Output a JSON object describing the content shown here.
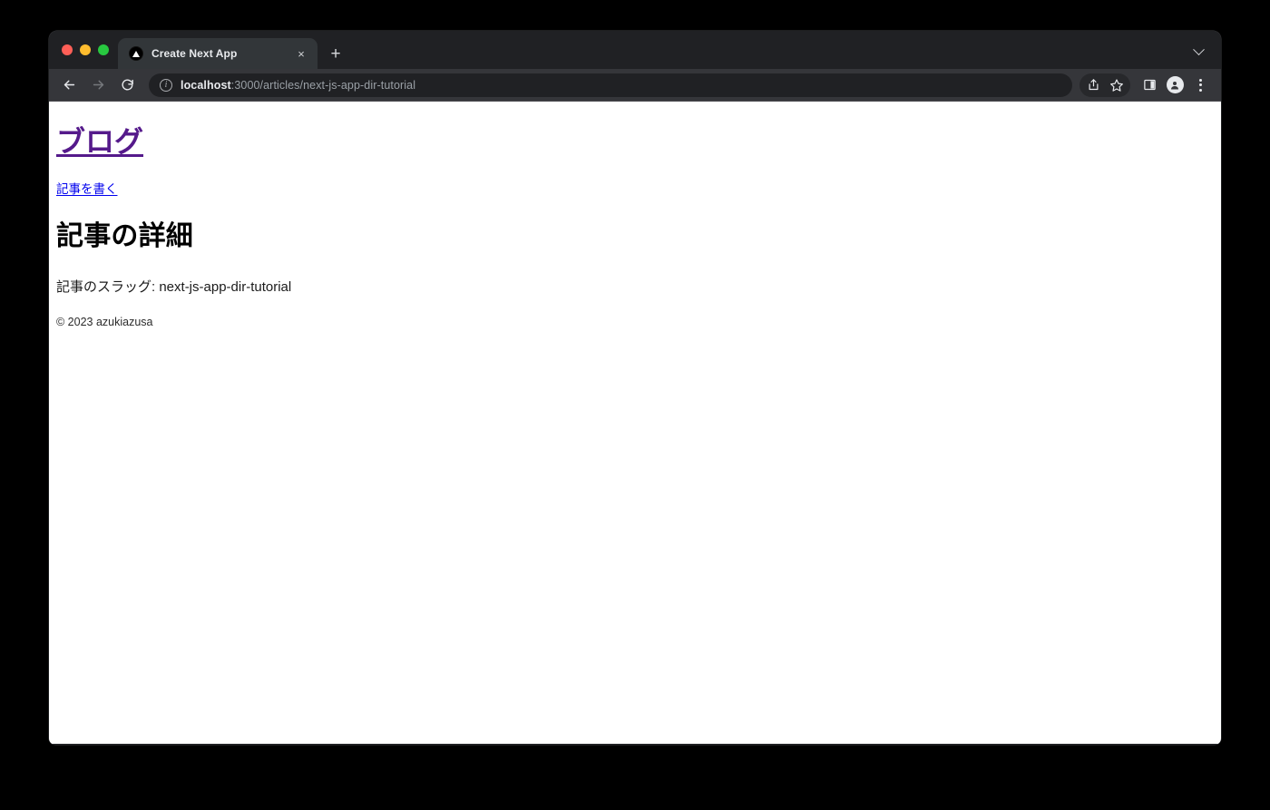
{
  "window": {
    "traffic_lights": [
      "close",
      "minimize",
      "maximize"
    ]
  },
  "tab_strip": {
    "tab": {
      "title": "Create Next App",
      "favicon": "nextjs-logo-icon",
      "close_label": "×"
    },
    "new_tab_label": "+",
    "tab_list_icon": "chevron-down-icon"
  },
  "toolbar": {
    "back_icon": "arrow-left-icon",
    "forward_icon": "arrow-right-icon",
    "reload_icon": "reload-icon",
    "security_icon": "info-circle-icon",
    "url": {
      "host": "localhost",
      "rest": ":3000/articles/next-js-app-dir-tutorial",
      "full": "localhost:3000/articles/next-js-app-dir-tutorial"
    },
    "share_icon": "share-icon",
    "bookmark_icon": "star-icon",
    "side_panel_icon": "side-panel-icon",
    "profile_icon": "profile-avatar-icon",
    "menu_icon": "kebab-menu-icon"
  },
  "page": {
    "site_title": "ブログ",
    "write_article_link": "記事を書く",
    "heading": "記事の詳細",
    "slug_text": "記事のスラッグ: next-js-app-dir-tutorial",
    "footer": "© 2023 azukiazusa"
  },
  "colors": {
    "desktop_background": "#000000",
    "tab_strip": "#202124",
    "active_tab": "#323639",
    "toolbar": "#35363a",
    "omnibox": "#202124",
    "page_background": "#ffffff",
    "visited_link": "#551a8b",
    "link": "#0000ee",
    "text": "#000000"
  }
}
